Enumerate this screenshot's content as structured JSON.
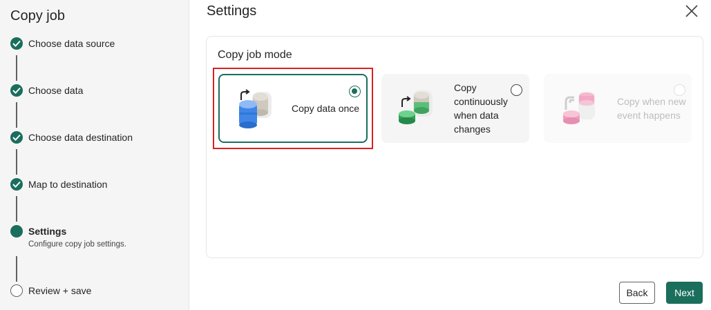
{
  "sidebar": {
    "title": "Copy job",
    "steps": [
      {
        "label": "Choose data source",
        "state": "done"
      },
      {
        "label": "Choose data",
        "state": "done"
      },
      {
        "label": "Choose data destination",
        "state": "done"
      },
      {
        "label": "Map to destination",
        "state": "done"
      },
      {
        "label": "Settings",
        "state": "current",
        "description": "Configure copy job settings."
      },
      {
        "label": "Review + save",
        "state": "todo"
      }
    ]
  },
  "main": {
    "title": "Settings",
    "close_icon": "close-icon",
    "section_title": "Copy job mode",
    "modes": [
      {
        "label": "Copy data once",
        "selected": true,
        "disabled": false,
        "icon": "copy-once-icon"
      },
      {
        "label": "Copy continuously when data changes",
        "selected": false,
        "disabled": false,
        "icon": "copy-continuous-icon"
      },
      {
        "label": "Copy when new event happens",
        "selected": false,
        "disabled": true,
        "icon": "copy-event-icon"
      }
    ]
  },
  "footer": {
    "back_label": "Back",
    "next_label": "Next"
  },
  "colors": {
    "accent": "#1a6e5c",
    "highlight": "#d92020"
  }
}
